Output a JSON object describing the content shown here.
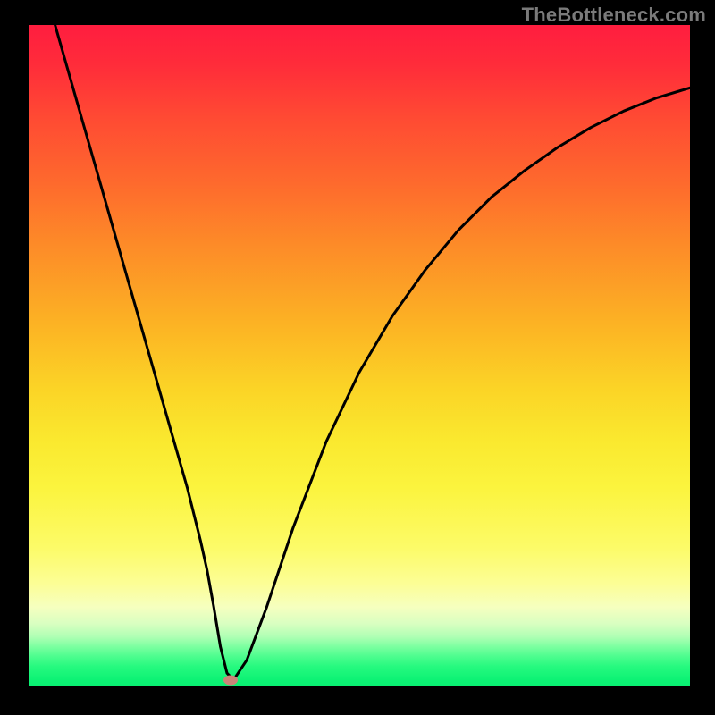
{
  "watermark": "TheBottleneck.com",
  "chart_data": {
    "type": "line",
    "title": "",
    "xlabel": "",
    "ylabel": "",
    "xlim": [
      0,
      100
    ],
    "ylim": [
      0,
      100
    ],
    "grid": false,
    "legend": false,
    "series": [
      {
        "name": "bottleneck-curve",
        "x": [
          4,
          6,
          8,
          10,
          12,
          14,
          16,
          18,
          20,
          22,
          24,
          26,
          27,
          28,
          29,
          30,
          31,
          33,
          36,
          40,
          45,
          50,
          55,
          60,
          65,
          70,
          75,
          80,
          85,
          90,
          95,
          100
        ],
        "y": [
          100,
          93,
          86,
          79,
          72,
          65,
          58,
          51,
          44,
          37,
          30,
          22,
          17.5,
          12,
          6,
          2,
          1,
          4,
          12,
          24,
          37,
          47.5,
          56,
          63,
          69,
          74,
          78,
          81.5,
          84.5,
          87,
          89,
          90.5
        ]
      }
    ],
    "annotations": [
      {
        "name": "min-marker",
        "x": 30.5,
        "y": 1.0,
        "color": "#c98579"
      }
    ],
    "background_gradient": {
      "stops": [
        {
          "pos": 0,
          "color": "#FF1D3F"
        },
        {
          "pos": 0.55,
          "color": "#FBD426"
        },
        {
          "pos": 0.88,
          "color": "#F6FFBF"
        },
        {
          "pos": 1.0,
          "color": "#09F072"
        }
      ]
    }
  },
  "colors": {
    "curve": "#000000",
    "frame": "#000000",
    "marker": "#c98579",
    "watermark": "#7a7a7a"
  }
}
